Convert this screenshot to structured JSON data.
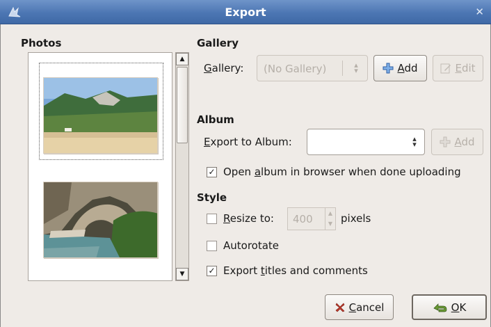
{
  "window": {
    "title": "Export",
    "close_icon": "close-icon"
  },
  "photos": {
    "title": "Photos"
  },
  "gallery": {
    "section_title": "Gallery",
    "label_mnemonic": "G",
    "label_rest": "allery:",
    "selected": "(No Gallery)",
    "add_mnemonic": "A",
    "add_rest": "dd",
    "edit_mnemonic": "E",
    "edit_rest": "dit"
  },
  "album": {
    "section_title": "Album",
    "label_mnemonic": "E",
    "label_rest": "xport to Album:",
    "selected": "",
    "add_mnemonic": "A",
    "add_rest": "dd",
    "open_pre": "Open ",
    "open_mnemonic": "a",
    "open_post": "lbum in browser when done uploading",
    "open_checked": true
  },
  "style": {
    "section_title": "Style",
    "resize_mnemonic": "R",
    "resize_rest": "esize to:",
    "resize_checked": false,
    "resize_value": "400",
    "pixels_label": "pixels",
    "autorotate_label": "Autorotate",
    "autorotate_checked": false,
    "export_pre": "Export ",
    "export_mnemonic": "t",
    "export_post": "itles and comments",
    "export_checked": true
  },
  "footer": {
    "cancel_mnemonic": "C",
    "cancel_rest": "ancel",
    "ok_mnemonic": "O",
    "ok_rest": "K"
  },
  "colors": {
    "titlebar": "#4c76b3",
    "dialog_bg": "#efebe7",
    "cancel_icon": "#c0392b",
    "ok_icon": "#5a8a2a",
    "add_icon": "#3e78c8"
  }
}
